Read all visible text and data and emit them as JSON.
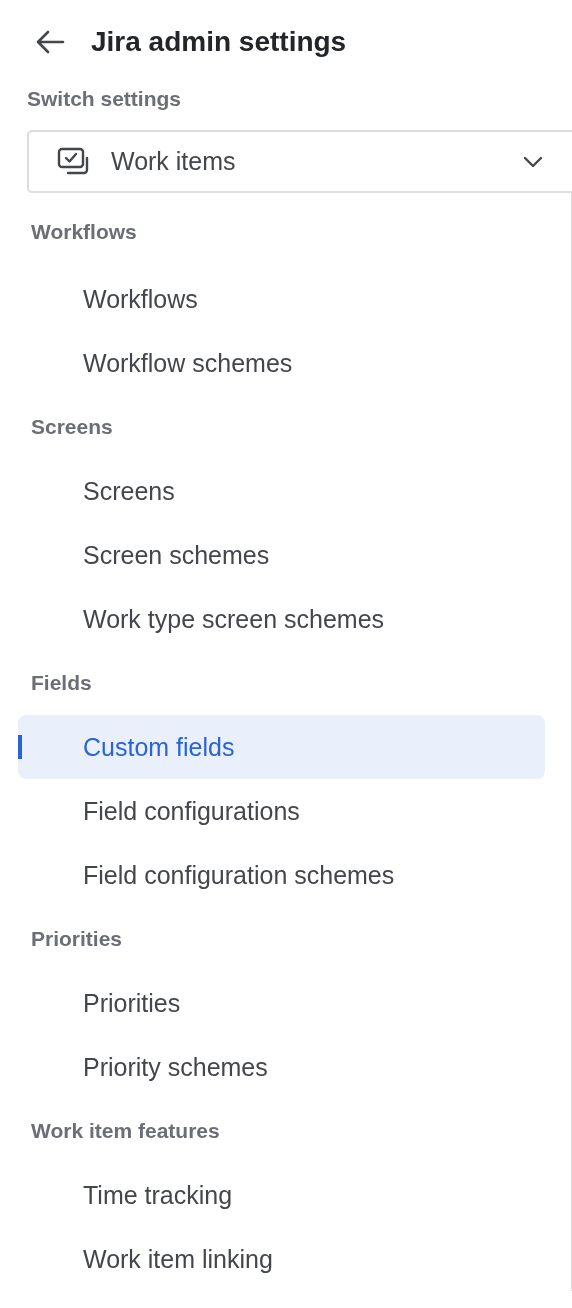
{
  "header": {
    "title": "Jira admin settings"
  },
  "switcher": {
    "label": "Switch settings",
    "value": "Work items"
  },
  "sections": [
    {
      "heading": "Workflows",
      "items": [
        {
          "label": "Workflows",
          "selected": false
        },
        {
          "label": "Workflow schemes",
          "selected": false
        }
      ]
    },
    {
      "heading": "Screens",
      "items": [
        {
          "label": "Screens",
          "selected": false
        },
        {
          "label": "Screen schemes",
          "selected": false
        },
        {
          "label": "Work type screen schemes",
          "selected": false
        }
      ]
    },
    {
      "heading": "Fields",
      "items": [
        {
          "label": "Custom fields",
          "selected": true
        },
        {
          "label": "Field configurations",
          "selected": false
        },
        {
          "label": "Field configuration schemes",
          "selected": false
        }
      ]
    },
    {
      "heading": "Priorities",
      "items": [
        {
          "label": "Priorities",
          "selected": false
        },
        {
          "label": "Priority schemes",
          "selected": false
        }
      ]
    },
    {
      "heading": "Work item features",
      "items": [
        {
          "label": "Time tracking",
          "selected": false
        },
        {
          "label": "Work item linking",
          "selected": false
        }
      ]
    }
  ]
}
